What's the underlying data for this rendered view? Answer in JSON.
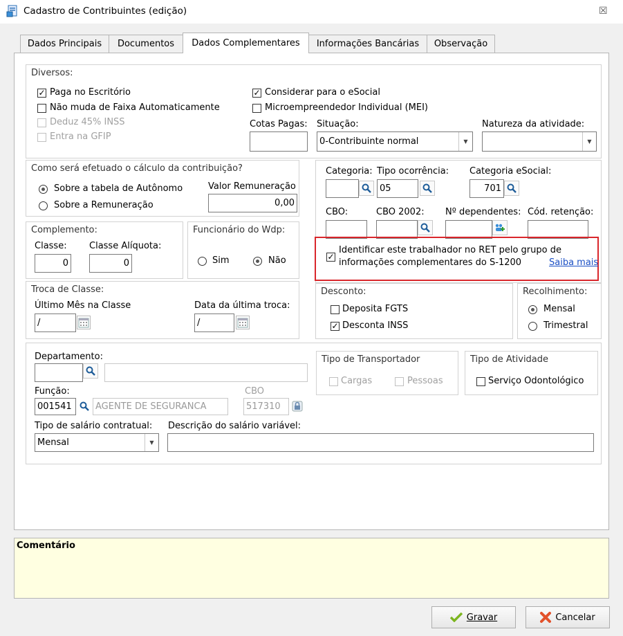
{
  "window": {
    "title": "Cadastro de Contribuintes (edição)",
    "close": "☒"
  },
  "tabs": [
    "Dados Principais",
    "Documentos",
    "Dados Complementares",
    "Informações Bancárias",
    "Observação"
  ],
  "diversos": {
    "title": "Diversos:",
    "paga_escritorio": "Paga no Escritório",
    "nao_muda_faixa": "Não muda de Faixa Automaticamente",
    "deduz_inss": "Deduz 45% INSS",
    "entra_gfip": "Entra na GFIP",
    "considerar_esocial": "Considerar para o eSocial",
    "mei": "Microempreendedor Individual (MEI)",
    "cotas_label": "Cotas Pagas:",
    "cotas_value": "",
    "situacao_label": "Situação:",
    "situacao_value": "0-Contribuinte normal",
    "natureza_label": "Natureza da atividade:",
    "natureza_value": ""
  },
  "calculo": {
    "title": "Como será efetuado o cálculo da contribuição?",
    "opt_tabela": "Sobre a tabela de Autônomo",
    "opt_remuneracao": "Sobre a Remuneração",
    "valor_label": "Valor Remuneração",
    "valor_value": "0,00"
  },
  "categoria": {
    "categoria_label": "Categoria:",
    "categoria_value": "",
    "tipo_ocorrencia_label": "Tipo ocorrência:",
    "tipo_ocorrencia_value": "05",
    "categoria_esocial_label": "Categoria eSocial:",
    "categoria_esocial_value": "701",
    "cbo_label": "CBO:",
    "cbo2002_label": "CBO 2002:",
    "dependentes_label": "Nº dependentes:",
    "retencao_label": "Cód. retenção:"
  },
  "ret": {
    "text_line1": "Identificar este trabalhador no RET pelo grupo de",
    "text_line2": "informações complementares do S-1200",
    "link": "Saiba mais"
  },
  "complemento": {
    "title": "Complemento:",
    "classe_label": "Classe:",
    "classe_value": "0",
    "aliquota_label": "Classe Alíquota:",
    "aliquota_value": "0"
  },
  "funcionario": {
    "title": "Funcionário do Wdp:",
    "sim": "Sim",
    "nao": "Não"
  },
  "troca": {
    "title": "Troca de Classe:",
    "ultimo_label": "Último Mês na Classe",
    "ultimo_value": "/",
    "data_label": "Data da última troca:",
    "data_value": "/"
  },
  "desconto": {
    "title": "Desconto:",
    "fgts": "Deposita FGTS",
    "inss": "Desconta INSS"
  },
  "recolhimento": {
    "title": "Recolhimento:",
    "mensal": "Mensal",
    "trimestral": "Trimestral"
  },
  "departamento": {
    "label": "Departamento:",
    "funcao_label": "Função:",
    "funcao_code": "001541",
    "funcao_name": "AGENTE DE SEGURANCA",
    "cbo_label": "CBO",
    "cbo_value": "517310",
    "tipo_salario_label": "Tipo de salário contratual:",
    "tipo_salario_value": "Mensal",
    "descricao_label": "Descrição do salário variável:",
    "descricao_value": ""
  },
  "transportador": {
    "title": "Tipo de Transportador",
    "cargas": "Cargas",
    "pessoas": "Pessoas"
  },
  "atividade": {
    "title": "Tipo de Atividade",
    "odonto": "Serviço Odontológico"
  },
  "comentario": {
    "label": "Comentário"
  },
  "buttons": {
    "gravar": "Gravar",
    "cancelar": "Cancelar"
  },
  "colors": {
    "highlight": "#d9262b",
    "link": "#1a4fc4",
    "comment_bg": "#ffffe1"
  }
}
